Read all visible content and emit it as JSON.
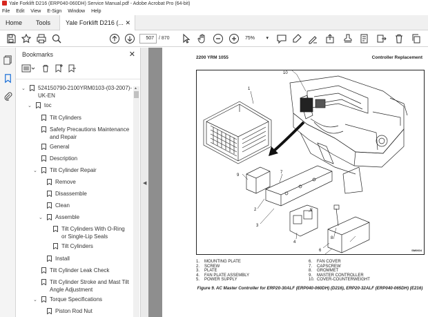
{
  "window": {
    "title": "Yale Forklift D216 (ERP040-060DH) Service Manual.pdf - Adobe Acrobat Pro (64-bit)"
  },
  "menu": [
    "File",
    "Edit",
    "View",
    "E-Sign",
    "Window",
    "Help"
  ],
  "tabs": {
    "home": "Home",
    "tools": "Tools",
    "doc": "Yale Forklift D216 (..."
  },
  "toolbar": {
    "page_current": "507",
    "page_total": "/ 870",
    "zoom": "75%"
  },
  "bookmarks": {
    "title": "Bookmarks",
    "items": [
      {
        "label": "524150790-2100YRM0103-(03-2007)-UK-EN",
        "expanded": true
      },
      {
        "label": "toc",
        "expanded": true
      },
      {
        "label": "Tilt Cylinders"
      },
      {
        "label": "Safety Precautions Maintenance and Repair"
      },
      {
        "label": "General"
      },
      {
        "label": "Description"
      },
      {
        "label": "Tilt Cylinder Repair",
        "expanded": true
      },
      {
        "label": "Remove"
      },
      {
        "label": "Disassemble"
      },
      {
        "label": "Clean"
      },
      {
        "label": "Assemble",
        "expanded": true
      },
      {
        "label": "Tilt Cylinders With O-Ring or Single-Lip Seals"
      },
      {
        "label": "Tilt Cylinders"
      },
      {
        "label": "Install"
      },
      {
        "label": "Tilt Cylinder Leak Check"
      },
      {
        "label": "Tilt Cylinder Stroke and Mast Tilt Angle Adjustment"
      },
      {
        "label": "Torque Specifications",
        "expanded": true
      },
      {
        "label": "Piston Rod Nut"
      }
    ]
  },
  "page": {
    "header_left": "2200 YRM 1055",
    "header_right": "Controller Replacement",
    "figure_code": "SM0604",
    "callouts": [
      "1",
      "2",
      "3",
      "4",
      "5",
      "6",
      "7",
      "8",
      "9",
      "10"
    ],
    "legend_left": [
      {
        "n": "1.",
        "t": "MOUNTING PLATE"
      },
      {
        "n": "2.",
        "t": "SCREW"
      },
      {
        "n": "3.",
        "t": "PLATE"
      },
      {
        "n": "4.",
        "t": "FAN PLATE ASSEMBLY"
      },
      {
        "n": "5.",
        "t": "POWER SUPPLY"
      }
    ],
    "legend_right": [
      {
        "n": "6.",
        "t": "FAN COVER"
      },
      {
        "n": "7.",
        "t": "CAPSCREW"
      },
      {
        "n": "8.",
        "t": "GROMMET"
      },
      {
        "n": "9.",
        "t": "MASTER CONTROLLER"
      },
      {
        "n": "10.",
        "t": "COVER-COUNTERWEIGHT"
      }
    ],
    "caption": "Figure 9. AC Master Controller for ERP20-30ALF (ERP040-060DH) (D216), ERP20-32ALF (ERP040-065DH) (E216)"
  }
}
